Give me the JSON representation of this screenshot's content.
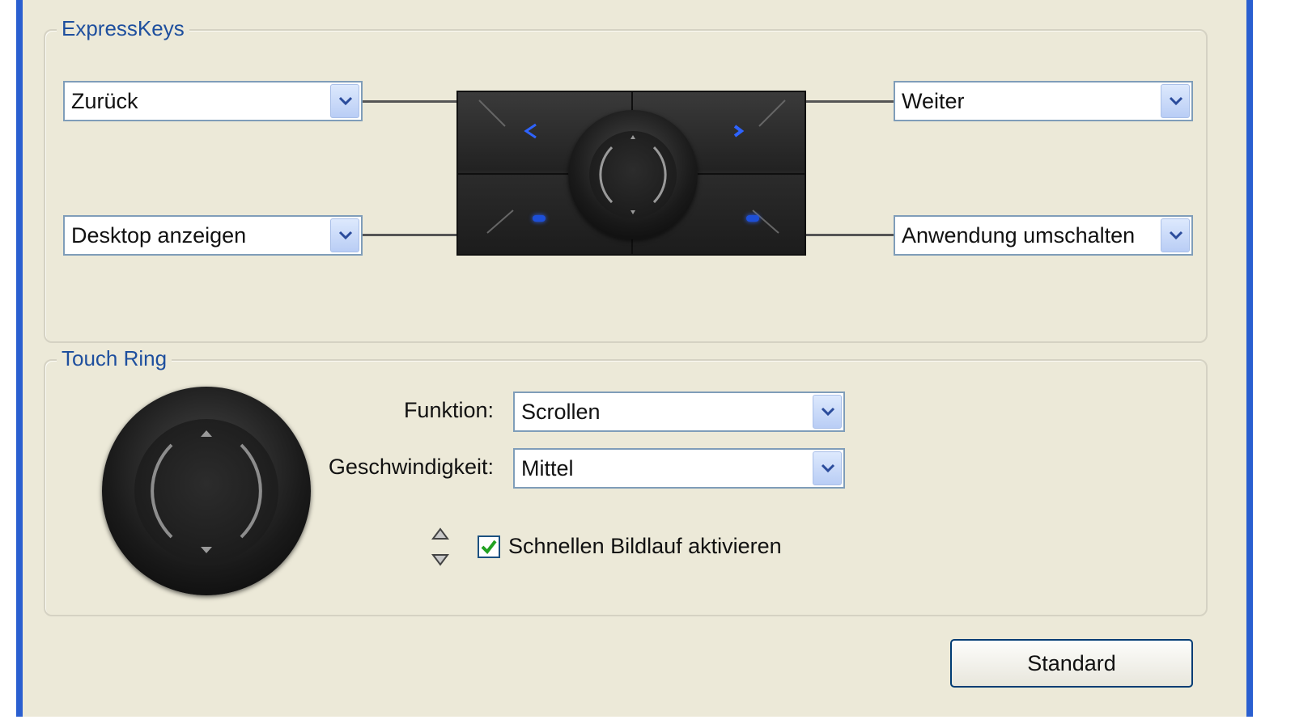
{
  "expresskeys": {
    "title": "ExpressKeys",
    "top_left": "Zurück",
    "bottom_left": "Desktop anzeigen",
    "top_right": "Weiter",
    "bottom_right": "Anwendung umschalten"
  },
  "touch_ring": {
    "title": "Touch Ring",
    "function_label": "Funktion:",
    "function_value": "Scrollen",
    "speed_label": "Geschwindigkeit:",
    "speed_value": "Mittel",
    "fast_scroll_label": "Schnellen Bildlauf aktivieren",
    "fast_scroll_checked": true
  },
  "buttons": {
    "default": "Standard"
  },
  "colors": {
    "window_frame": "#2a5fd0",
    "dialog_bg": "#ece9d8",
    "group_title": "#1e4f9e",
    "led": "#1d4fd8",
    "check": "#21a121"
  },
  "icons": [
    "dropdown-arrow-icon",
    "ring-up-arrow-icon",
    "ring-down-arrow-icon",
    "checkmark-icon",
    "scroll-arrows-icon"
  ]
}
